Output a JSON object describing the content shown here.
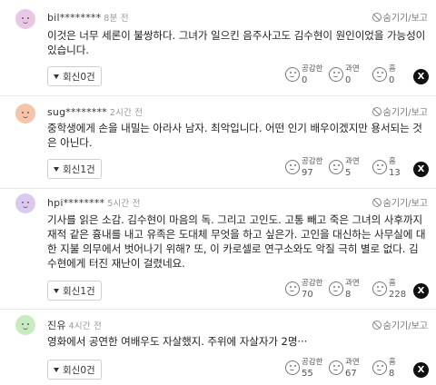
{
  "colors": {
    "avatar_colors": [
      "#e9c8e6",
      "#f6c4a8",
      "#dcc9ee",
      "#c8ebc0"
    ],
    "x_button": "#111111"
  },
  "common": {
    "hide_label": "숨기기/보고",
    "reaction_labels": [
      "공감한",
      "과연",
      "흠"
    ],
    "x_label": "X"
  },
  "comments": [
    {
      "user": "bil********",
      "time": "8분 전",
      "text": "이것은 너무 세론이 불쌍하다. 그녀가 일으킨 음주사고도 김수현이 원인이었을 가능성이 있습니다.",
      "reply_label": "회신0건",
      "counts": [
        "0",
        "0",
        "0"
      ]
    },
    {
      "user": "sug********",
      "time": "2시간 전",
      "text": "중학생에게 손을 내밀는 아라사 남자. 최악입니다. 어떤 인기 배우이겠지만 용서되는 것은 아닌다.",
      "reply_label": "회신1건",
      "counts": [
        "97",
        "5",
        "13"
      ]
    },
    {
      "user": "hpi********",
      "time": "5시간 전",
      "text": "기사를 읽은 소감. 김수현이 마음의 독. 그리고 고인도. 고통 빼고 죽은 그녀의 사후까지 재적 같은 흉내를 내고 유족은 도대체 무엇을 하고 싶은가. 고인을 대신하는 사무실에 대한 지불 의무에서 벗어나기 위해? 또, 이 카로셀로 연구소와도 악질 극히 별로 없다. 김수현에게 터진 재난이 걸렸네요.",
      "reply_label": "회신1건",
      "counts": [
        "70",
        "8",
        "228"
      ]
    },
    {
      "user": "진유",
      "time": "4시간 전",
      "text": "영화에서 공연한 여배우도 자살했지. 주위에 자살자가 2명···",
      "reply_label": "회신0건",
      "counts": [
        "55",
        "67",
        "8"
      ]
    }
  ]
}
